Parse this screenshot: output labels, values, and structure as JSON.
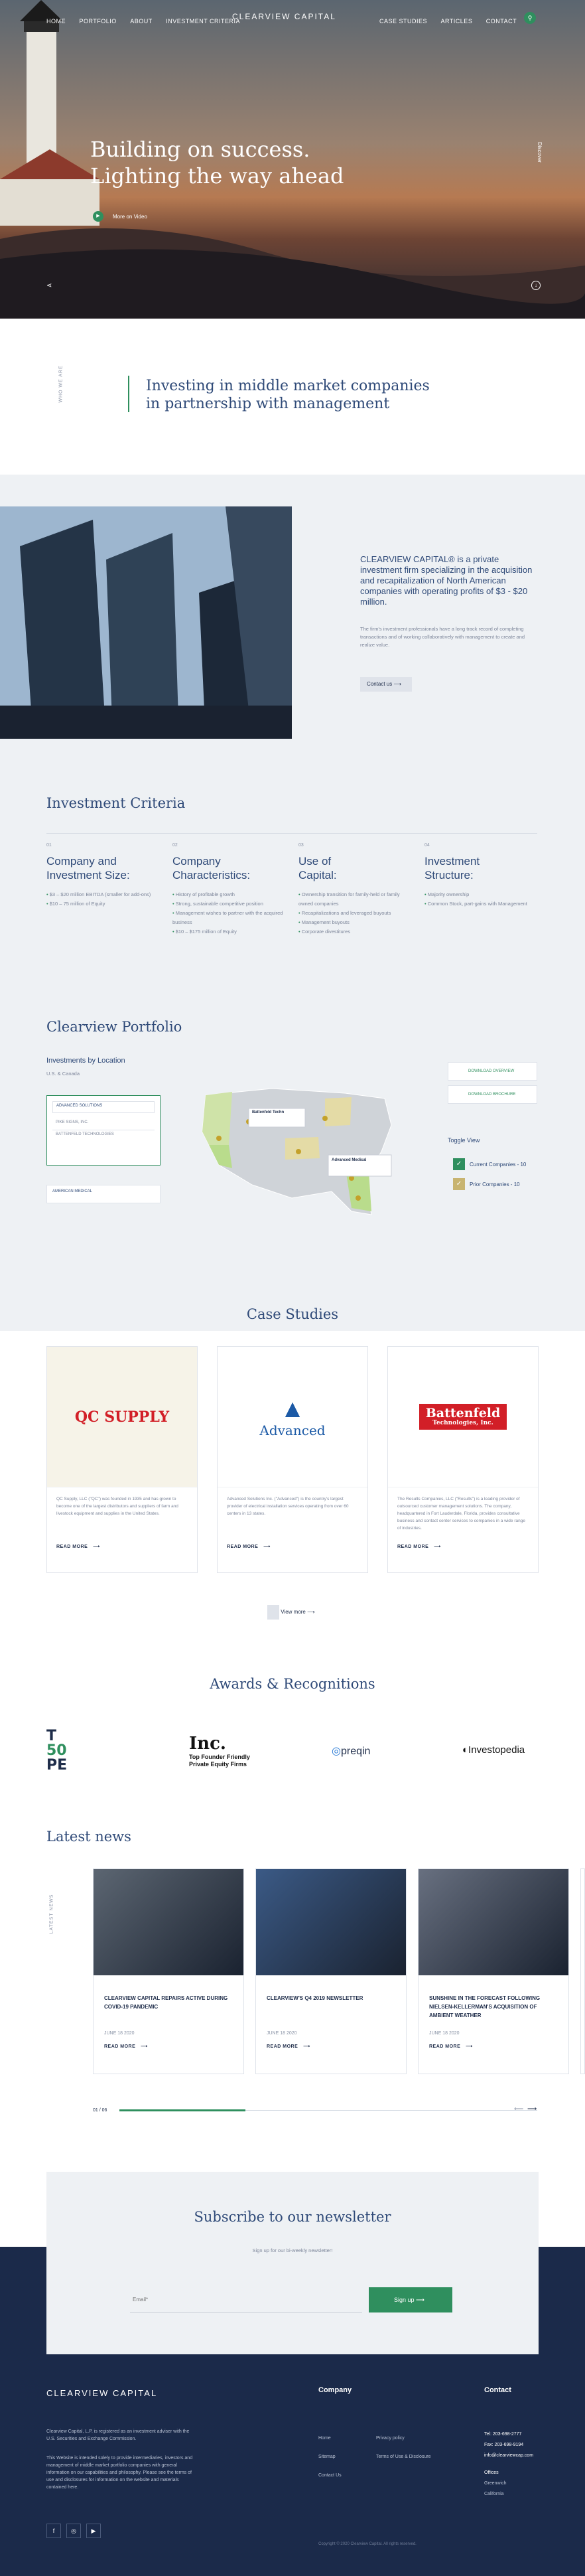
{
  "nav": {
    "left": [
      "HOME",
      "PORTFOLIO",
      "ABOUT",
      "INVESTMENT CRITERIA"
    ],
    "right": [
      "CASE STUDIES",
      "ARTICLES",
      "CONTACT"
    ],
    "logo": "CLEARVIEW CAPITAL"
  },
  "hero": {
    "title1": "Building on success.",
    "title2": "Lighting the way ahead",
    "button": "More on Video",
    "side_label": "Discover"
  },
  "intro": {
    "label": "WHO WE ARE",
    "title1": "Investing in middle market companies",
    "title2": "in partnership with management"
  },
  "about": {
    "text1": "CLEARVIEW CAPITAL® is a private investment firm specializing in the acquisition and recapitalization of North American companies with operating profits of $3 - $20 million.",
    "text2": "The firm's investment professionals have a long track record of completing transactions and of working collaboratively with management to create and realize value.",
    "button": "Contact us"
  },
  "criteria": {
    "title": "Investment Criteria",
    "cols": [
      {
        "num": "01",
        "head1": "Company and",
        "head2": "Investment Size:",
        "items": [
          "$3 – $20 million EBITDA (smaller for add-ons)",
          "$10 – 75 million of Equity"
        ]
      },
      {
        "num": "02",
        "head1": "Company",
        "head2": "Characteristics:",
        "items": [
          "History of profitable growth",
          "Strong, sustainable competitive position",
          "Management wishes to partner with the acquired business",
          "$10 – $175 million of Equity"
        ]
      },
      {
        "num": "03",
        "head1": "Use of",
        "head2": "Capital:",
        "items": [
          "Ownership transition for family-held or family owned companies",
          "Recapitalizations and leveraged buyouts",
          "Management buyouts",
          "Corporate divestitures"
        ]
      },
      {
        "num": "04",
        "head1": "Investment",
        "head2": "Structure:",
        "items": [
          "Majority ownership",
          "Common Stock, part-gains with Management"
        ]
      }
    ]
  },
  "portfolio": {
    "title": "Clearview Portfolio",
    "sub": "Investments by Location",
    "region": "U.S. & Canada",
    "list": [
      "ADVANCED SOLUTIONS",
      "PIKE SIGNS, INC.",
      "BATTENFELD TECHNOLOGIES",
      "AMERICAN MEDICAL"
    ],
    "download1": "DOWNLOAD OVERVIEW",
    "download2": "DOWNLOAD BROCHURE",
    "toggle": "Toggle View",
    "opt1": "Current Companies - 10",
    "opt2": "Prior Companies - 10",
    "pin1": "Battenfeld Techn",
    "pin2": "Advanced Medical"
  },
  "cases": {
    "title": "Case Studies",
    "items": [
      {
        "logo": "QC SUPPLY",
        "text": "QC Supply, LLC (\"QC\") was founded in 1935 and has grown to become one of the largest distributors and suppliers of farm and livestock equipment and supplies in the United States.",
        "more": "READ MORE"
      },
      {
        "logo": "Advanced",
        "text": "Advanced Solutions Inc. (\"Advanced\") is the country's largest provider of electrical installation services operating from over 60 centers in 13 states.",
        "more": "READ MORE"
      },
      {
        "logo": "Battenfeld",
        "logo2": "Technologies, Inc.",
        "text": "The Results Companies, LLC (\"Results\") is a leading provider of outsourced customer management solutions. The company, headquartered in Fort Lauderdale, Florida, provides consultative business and contact center services to companies in a wide range of industries.",
        "more": "READ MORE"
      }
    ],
    "view_more": "View more"
  },
  "awards": {
    "title": "Awards & Recognitions",
    "items": [
      "TOP 50 PE",
      "Inc. Top Founder Friendly Private Equity Firms",
      "preqin",
      "Investopedia"
    ]
  },
  "news": {
    "title": "Latest news",
    "side": "LATEST NEWS",
    "items": [
      {
        "title": "CLEARVIEW CAPITAL REPAIRS ACTIVE DURING COVID-19 PANDEMIC",
        "date": "JUNE 18 2020",
        "more": "READ MORE"
      },
      {
        "title": "CLEARVIEW'S Q4 2019 NEWSLETTER",
        "date": "JUNE 18 2020",
        "more": "READ MORE"
      },
      {
        "title": "SUNSHINE IN THE FORECAST FOLLOWING NIELSEN-KELLERMAN'S ACQUISITION OF AMBIENT WEATHER",
        "date": "JUNE 18 2020",
        "more": "READ MORE"
      }
    ],
    "counter": "01 / 06"
  },
  "newsletter": {
    "title": "Subscribe to our newsletter",
    "sub": "Sign up for our bi-weekly newsletter!",
    "placeholder": "Email*",
    "button": "Sign up"
  },
  "footer": {
    "logo": "CLEARVIEW CAPITAL",
    "text1": "Clearview Capital, L.P. is registered as an investment adviser with the U.S. Securities and Exchange Commission.",
    "text2": "This Website is intended solely to provide intermediaries, investors and management of middle market portfolio companies with general information on our capabilities and philosophy. Please see the terms of use and disclosures for information on the website and materials contained here.",
    "company": "Company",
    "links": [
      "Home",
      "Sitemap",
      "Contact Us",
      "Privacy policy",
      "Terms of Use & Disclosure"
    ],
    "contact": "Contact",
    "tel1": "Tel: 203-698-2777",
    "fax": "Fax: 203-698-9194",
    "email": "info@clearviewcap.com",
    "offices": "Offices",
    "office1": "Greenwich",
    "office2": "California",
    "copyright": "Copyright © 2020 Clearview Capital. All rights reserved."
  },
  "colors": {
    "navy": "#1f2d4a",
    "green": "#2f8f5e",
    "red": "#d21f27"
  }
}
